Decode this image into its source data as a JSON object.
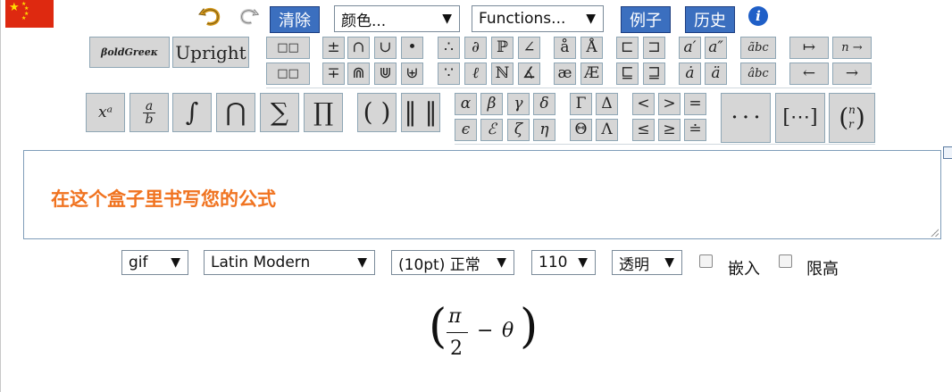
{
  "toolbar": {
    "undo_icon": "undo-arrow-icon",
    "redo_icon": "redo-arrow-icon",
    "clear_label": "清除",
    "color_select": "颜色...",
    "functions_select": "Functions...",
    "examples_label": "例子",
    "history_label": "历史",
    "info_glyph": "i"
  },
  "buttons": {
    "boldgreek": "βoldGreeκ",
    "upright": "Upright",
    "box_pair": "□□",
    "pm": "±",
    "cap": "∩",
    "cup": "∪",
    "bullet": "•",
    "mp": "∓",
    "Cap": "⋒",
    "Cup": "⋓",
    "uplus": "⊎",
    "therefore": "∴",
    "partial": "∂",
    "bbP": "ℙ",
    "angle": "∠",
    "because": "∵",
    "imath": "ℓ",
    "bbN": "ℕ",
    "measangle": "∡",
    "aring": "å",
    "Aring": "Å",
    "ae": "æ",
    "AE": "Æ",
    "sqsubset": "⊏",
    "sqsupset": "⊐",
    "sqsubseteq": "⊑",
    "sqsupseteq": "⊒",
    "aprime": "a′",
    "adprime": "a″",
    "adot": "ȧ",
    "addot": "ä",
    "widetilde": "ãbc",
    "widehat": "âbc",
    "mapsto": "↦",
    "n_to": "n →",
    "leftarrow": "←",
    "rightarrow": "→",
    "xpow": "xᵃ",
    "frac_top": "a",
    "frac_bot": "b",
    "integral": "∫",
    "bigcap": "⋂",
    "sum": "∑",
    "prod": "∏",
    "parens": "( )",
    "norm": "‖ ‖",
    "alpha": "α",
    "beta": "β",
    "gamma": "γ",
    "delta": "δ",
    "epsilon": "ϵ",
    "varepsilon": "ℰ",
    "zeta": "ζ",
    "eta": "η",
    "Gamma": "Γ",
    "Delta": "Δ",
    "Theta": "Θ",
    "Lambda": "Λ",
    "lt": "<",
    "gt": ">",
    "eq": "=",
    "le": "≤",
    "ge": "≥",
    "doteq": "≐",
    "dots": "· · ·",
    "matrix": "[⋯]",
    "binom_n": "n",
    "binom_r": "r"
  },
  "editor": {
    "placeholder": "在这个盒子里书写您的公式"
  },
  "options": {
    "format": "gif",
    "font": "Latin Modern",
    "size": "(10pt) 正常",
    "dpi": "110",
    "background": "透明",
    "inline_label": "嵌入",
    "limit_label": "限高"
  },
  "preview": {
    "numerator": "π",
    "denominator": "2",
    "minus": "−",
    "theta": "θ"
  },
  "colors": {
    "accent_blue": "#3b6fbf",
    "placeholder_orange": "#f07320",
    "flag_red": "#de2910",
    "flag_yellow": "#ffde00"
  }
}
